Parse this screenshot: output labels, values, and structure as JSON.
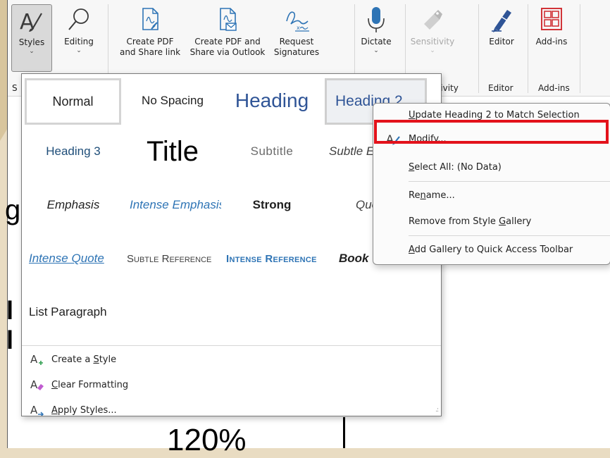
{
  "ribbon": {
    "buttons": [
      {
        "id": "styles",
        "label": "Styles",
        "icon": "styles-icon",
        "has_dropdown": true
      },
      {
        "id": "editing",
        "label": "Editing",
        "icon": "magnifier-icon",
        "has_dropdown": true
      },
      {
        "id": "create_pdf_share",
        "label_line1": "Create PDF",
        "label_line2": "and Share link",
        "icon": "pdf-share-icon"
      },
      {
        "id": "create_pdf_outlook",
        "label_line1": "Create PDF and",
        "label_line2": "Share via Outlook",
        "icon": "pdf-outlook-icon"
      },
      {
        "id": "request_signatures",
        "label_line1": "Request",
        "label_line2": "Signatures",
        "icon": "signature-icon"
      },
      {
        "id": "dictate",
        "label": "Dictate",
        "icon": "microphone-icon",
        "has_dropdown": true
      },
      {
        "id": "sensitivity",
        "label": "Sensitivity",
        "icon": "sensitivity-icon",
        "has_dropdown": true,
        "disabled": true
      },
      {
        "id": "editor",
        "label": "Editor",
        "icon": "editor-pen-icon"
      },
      {
        "id": "addins",
        "label": "Add-ins",
        "icon": "addins-grid-icon"
      }
    ],
    "group_labels": {
      "styles_partial": "S",
      "sensitivity_partial": "sitivity",
      "editor": "Editor",
      "addins": "Add-ins"
    }
  },
  "document": {
    "left_edge_glyph_1": "g",
    "left_edge_glyph_2": "l",
    "left_edge_glyph_3": "l",
    "bottom_text": "120%"
  },
  "style_gallery": {
    "styles": [
      {
        "name": "Normal"
      },
      {
        "name": "No Spacing"
      },
      {
        "name": "Heading"
      },
      {
        "name": "Heading 2"
      },
      {
        "name": "Heading 3"
      },
      {
        "name": "Title"
      },
      {
        "name": "Subtitle"
      },
      {
        "name": "Subtle Emphasis"
      },
      {
        "name": "Emphasis"
      },
      {
        "name": "Intense Emphasis"
      },
      {
        "name": "Strong"
      },
      {
        "name": "Quote"
      },
      {
        "name": "Intense Quote"
      },
      {
        "name": "Subtle Reference"
      },
      {
        "name": "Intense Reference"
      },
      {
        "name": "Book Title"
      },
      {
        "name": "List Paragraph"
      }
    ],
    "commands": [
      {
        "label_pre": "Create a ",
        "label_acc": "S",
        "label_post": "tyle",
        "icon": "create-style-icon"
      },
      {
        "label_pre": "",
        "label_acc": "C",
        "label_post": "lear Formatting",
        "icon": "clear-formatting-icon"
      },
      {
        "label_pre": "",
        "label_acc": "A",
        "label_post": "pply Styles...",
        "icon": "apply-styles-icon"
      }
    ]
  },
  "context_menu": {
    "items": [
      {
        "pre": "",
        "acc": "U",
        "post": "pdate Heading 2 to Match Selection"
      },
      {
        "pre": "",
        "acc": "M",
        "post": "odify...",
        "icon": "modify-style-icon"
      },
      {
        "pre": "",
        "acc": "S",
        "post": "elect All: (No Data)"
      },
      {
        "pre": "Re",
        "acc": "n",
        "post": "ame..."
      },
      {
        "pre": "Remove from Style ",
        "acc": "G",
        "post": "allery"
      },
      {
        "pre": "",
        "acc": "A",
        "post": "dd Gallery to Quick Access Toolbar"
      }
    ]
  },
  "colors": {
    "accent_blue": "#2e74b5",
    "heading_blue": "#2f5496",
    "highlight_red": "#e3121b",
    "beige": "#e9dcc2"
  }
}
